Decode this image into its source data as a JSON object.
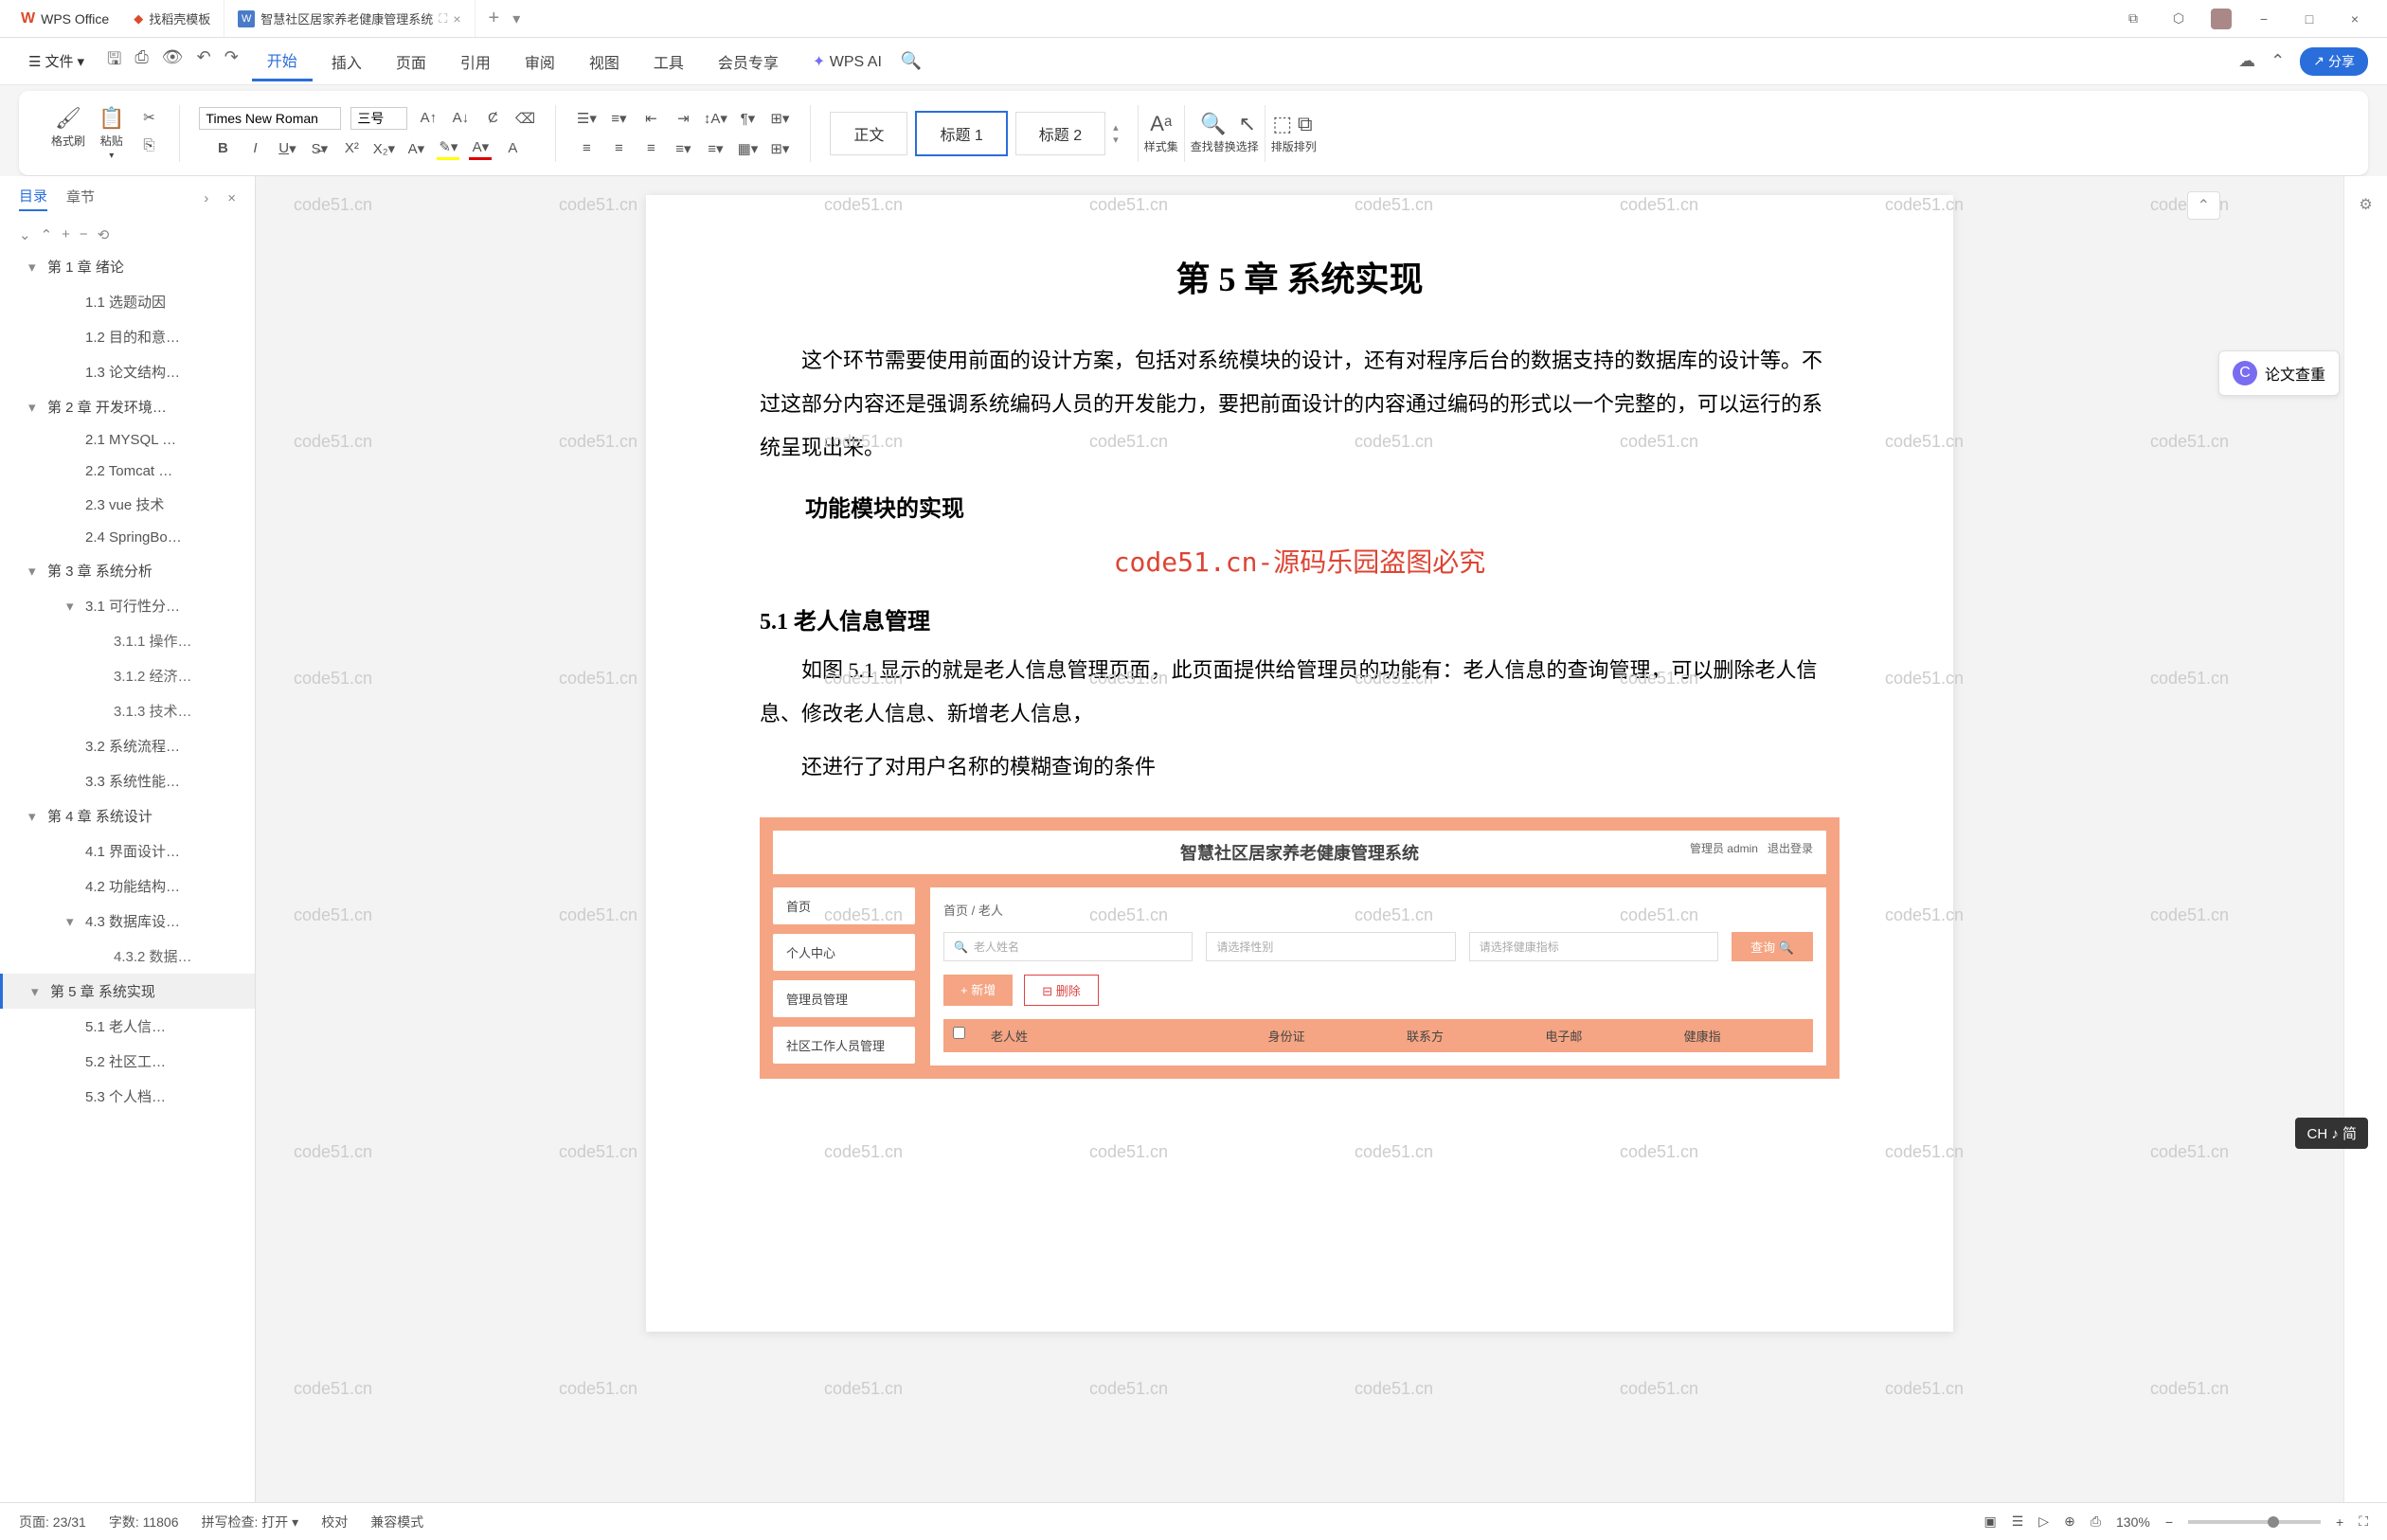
{
  "titlebar": {
    "app_name": "WPS Office",
    "tab2": "找稻壳模板",
    "tab3": "智慧社区居家养老健康管理系统",
    "tab3_icon": "W"
  },
  "menubar": {
    "file": "文件",
    "items": [
      "开始",
      "插入",
      "页面",
      "引用",
      "审阅",
      "视图",
      "工具",
      "会员专享",
      "WPS AI"
    ],
    "share": "分享"
  },
  "ribbon": {
    "format_brush": "格式刷",
    "paste": "粘贴",
    "font": "Times New Roman",
    "size": "三号",
    "styles": {
      "normal": "正文",
      "h1": "标题 1",
      "h2": "标题 2"
    },
    "style_set": "样式集",
    "find_replace": "查找替换",
    "select": "选择",
    "arrange": "排版",
    "arrange2": "排列"
  },
  "sidebar": {
    "tab_outline": "目录",
    "tab_chapter": "章节",
    "items": [
      {
        "t": "第 1 章 绪论",
        "l": 1,
        "a": true
      },
      {
        "t": "1.1 选题动因",
        "l": 2
      },
      {
        "t": "1.2 目的和意…",
        "l": 2
      },
      {
        "t": "1.3 论文结构…",
        "l": 2
      },
      {
        "t": "第 2 章 开发环境…",
        "l": 1,
        "a": true
      },
      {
        "t": "2.1 MYSQL …",
        "l": 2
      },
      {
        "t": "2.2 Tomcat …",
        "l": 2
      },
      {
        "t": "2.3 vue 技术",
        "l": 2
      },
      {
        "t": "2.4 SpringBo…",
        "l": 2
      },
      {
        "t": "第 3 章 系统分析",
        "l": 1,
        "a": true
      },
      {
        "t": "3.1 可行性分…",
        "l": 2,
        "a": true
      },
      {
        "t": "3.1.1 操作…",
        "l": 3
      },
      {
        "t": "3.1.2 经济…",
        "l": 3
      },
      {
        "t": "3.1.3 技术…",
        "l": 3
      },
      {
        "t": "3.2 系统流程…",
        "l": 2
      },
      {
        "t": "3.3 系统性能…",
        "l": 2
      },
      {
        "t": "第 4 章 系统设计",
        "l": 1,
        "a": true
      },
      {
        "t": "4.1 界面设计…",
        "l": 2
      },
      {
        "t": "4.2 功能结构…",
        "l": 2
      },
      {
        "t": "4.3 数据库设…",
        "l": 2,
        "a": true
      },
      {
        "t": "4.3.2 数据…",
        "l": 3
      },
      {
        "t": "第 5 章 系统实现",
        "l": 1,
        "a": true,
        "active": true
      },
      {
        "t": "5.1 老人信…",
        "l": 2
      },
      {
        "t": "5.2 社区工…",
        "l": 2
      },
      {
        "t": "5.3 个人档…",
        "l": 2
      }
    ]
  },
  "doc": {
    "chapter": "第 5 章  系统实现",
    "para1": "这个环节需要使用前面的设计方案，包括对系统模块的设计，还有对程序后台的数据支持的数据库的设计等。不过这部分内容还是强调系统编码人员的开发能力，要把前面设计的内容通过编码的形式以一个完整的，可以运行的系统呈现出来。",
    "sub1": "功能模块的实现",
    "watermark": "code51.cn-源码乐园盗图必究",
    "section51": "5.1 老人信息管理",
    "para2": "如图 5.1 显示的就是老人信息管理页面，此页面提供给管理员的功能有：老人信息的查询管理，可以删除老人信息、修改老人信息、新增老人信息，",
    "para3": "还进行了对用户名称的模糊查询的条件"
  },
  "embedded": {
    "title": "智慧社区居家养老健康管理系统",
    "admin": "管理员 admin",
    "logout": "退出登录",
    "nav": [
      "首页",
      "个人中心",
      "管理员管理",
      "社区工作人员管理"
    ],
    "breadcrumb_home": "首页",
    "breadcrumb_current": "老人",
    "search1": "老人姓名",
    "search2": "请选择性别",
    "search3": "请选择健康指标",
    "search_btn": "查询",
    "add_btn": "+ 新增",
    "del_btn": "⊟ 删除",
    "cols": [
      "",
      "老人姓",
      "",
      "身份证",
      "联系方",
      "电子邮",
      "健康指"
    ]
  },
  "check": {
    "label": "论文查重"
  },
  "status": {
    "page": "页面: 23/31",
    "words": "字数: 11806",
    "spell": "拼写检查: 打开",
    "proof": "校对",
    "compat": "兼容模式",
    "zoom": "130%"
  },
  "ime": "CH ♪ 简",
  "wm_text": "code51.cn"
}
